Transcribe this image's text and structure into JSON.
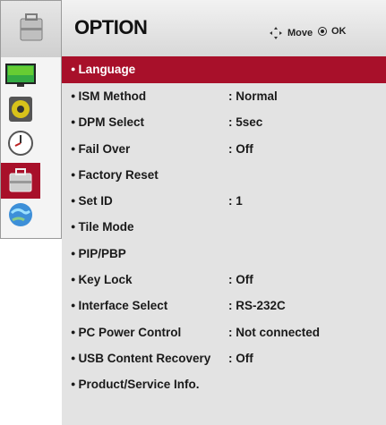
{
  "menu": {
    "title": "OPTION",
    "hints": {
      "move": "Move",
      "ok": "OK"
    }
  },
  "sidebar": {
    "icons": [
      "picture-icon",
      "audio-icon",
      "time-icon",
      "option-icon",
      "network-icon"
    ],
    "selected": "option-icon"
  },
  "options": [
    {
      "label": "Language",
      "value": ""
    },
    {
      "label": "ISM Method",
      "value": ": Normal"
    },
    {
      "label": "DPM Select",
      "value": ": 5sec"
    },
    {
      "label": "Fail Over",
      "value": ": Off"
    },
    {
      "label": "Factory Reset",
      "value": ""
    },
    {
      "label": "Set ID",
      "value": ": 1"
    },
    {
      "label": "Tile Mode",
      "value": ""
    },
    {
      "label": "PIP/PBP",
      "value": ""
    },
    {
      "label": "Key Lock",
      "value": ": Off"
    },
    {
      "label": "Interface Select",
      "value": ": RS-232C"
    },
    {
      "label": "PC Power Control",
      "value": ": Not connected"
    },
    {
      "label": "USB Content Recovery",
      "value": ": Off"
    },
    {
      "label": "Product/Service Info.",
      "value": ""
    }
  ],
  "colors": {
    "accent": "#a8102a",
    "panel": "#e3e3e3"
  }
}
